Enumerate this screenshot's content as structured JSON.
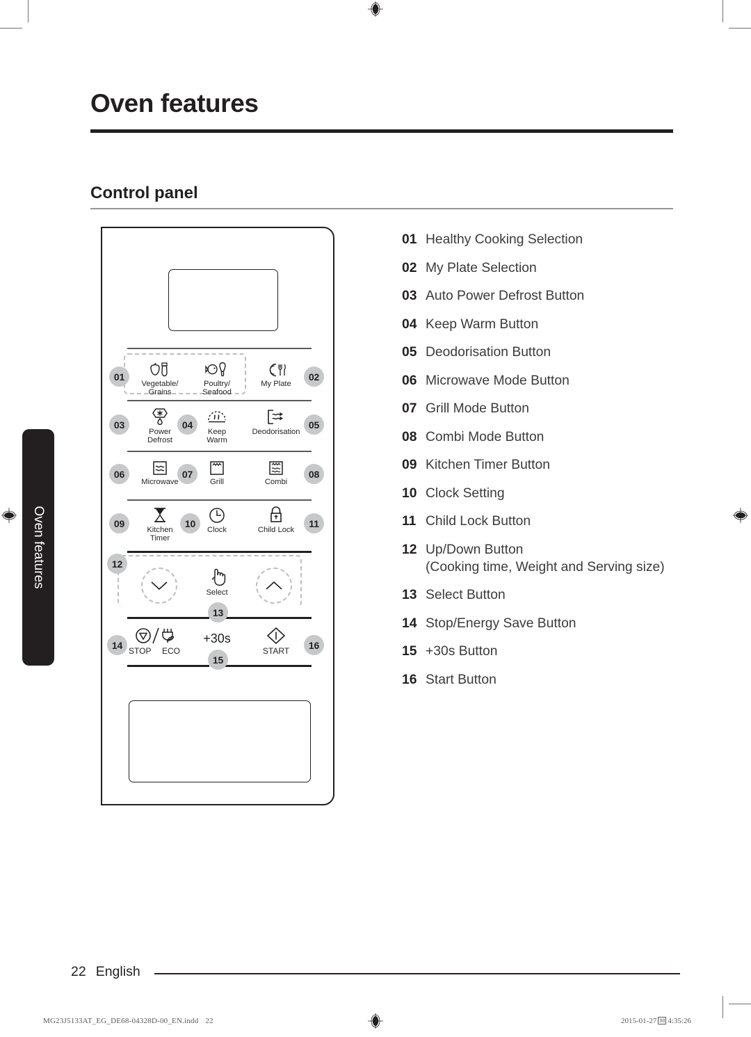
{
  "page": {
    "chapter_title": "Oven features",
    "section_title": "Control panel",
    "side_tab_label": "Oven features",
    "folio_page": "22",
    "folio_language": "English",
    "imprint": "MG23J5133AT_EG_DE68-04328D-00_EN.indd",
    "imprint_page": "22",
    "timestamp_date": "2015-01-27",
    "timestamp_icon": "88",
    "timestamp_time": "4:35:26"
  },
  "colors": {
    "ink": "#231f20",
    "badge_fill": "#c7c8ca",
    "dash_gray": "#bcbec0",
    "rule_gray": "#939598",
    "body_text": "#3a3a3c"
  },
  "control_panel": {
    "keys": [
      {
        "id": "vegetable-grains",
        "label": "Vegetable/\nGrains",
        "icon": "vegetable-icon"
      },
      {
        "id": "poultry-seafood",
        "label": "Poultry/\nSeafood",
        "icon": "poultry-seafood-icon"
      },
      {
        "id": "my-plate",
        "label": "My Plate",
        "icon": "plate-cutlery-icon"
      },
      {
        "id": "power-defrost",
        "label": "Power\nDefrost",
        "icon": "snowflake-droplet-icon"
      },
      {
        "id": "keep-warm",
        "label": "Keep\nWarm",
        "icon": "steam-warm-icon"
      },
      {
        "id": "deodorisation",
        "label": "Deodorisation",
        "icon": "air-vent-icon"
      },
      {
        "id": "microwave",
        "label": "Microwave",
        "icon": "microwave-waves-icon"
      },
      {
        "id": "grill",
        "label": "Grill",
        "icon": "grill-element-icon"
      },
      {
        "id": "combi",
        "label": "Combi",
        "icon": "combi-grill-waves-icon"
      },
      {
        "id": "kitchen-timer",
        "label": "Kitchen\nTimer",
        "icon": "hourglass-icon"
      },
      {
        "id": "clock",
        "label": "Clock",
        "icon": "clock-icon"
      },
      {
        "id": "child-lock",
        "label": "Child Lock",
        "icon": "padlock-icon"
      },
      {
        "id": "down",
        "label": "",
        "icon": "chevron-down-icon"
      },
      {
        "id": "select",
        "label": "Select",
        "icon": "pointing-hand-icon"
      },
      {
        "id": "up",
        "label": "",
        "icon": "chevron-up-icon"
      },
      {
        "id": "stop-eco",
        "label": "STOP   ECO",
        "icon": "stop-eco-icon"
      },
      {
        "id": "plus-30s",
        "label": "+30s",
        "icon": ""
      },
      {
        "id": "start",
        "label": "START",
        "icon": "start-diamond-icon"
      }
    ],
    "callouts": [
      "01",
      "02",
      "03",
      "04",
      "05",
      "06",
      "07",
      "08",
      "09",
      "10",
      "11",
      "12",
      "13",
      "14",
      "15",
      "16"
    ],
    "stop_label": "STOP",
    "eco_label": "ECO",
    "plus30_label": "+30s",
    "start_label": "START"
  },
  "legend": {
    "items": [
      {
        "num": "01",
        "text": "Healthy Cooking Selection"
      },
      {
        "num": "02",
        "text": "My Plate Selection"
      },
      {
        "num": "03",
        "text": "Auto Power Defrost Button"
      },
      {
        "num": "04",
        "text": "Keep Warm Button"
      },
      {
        "num": "05",
        "text": "Deodorisation Button"
      },
      {
        "num": "06",
        "text": "Microwave Mode Button"
      },
      {
        "num": "07",
        "text": "Grill Mode Button"
      },
      {
        "num": "08",
        "text": "Combi Mode Button"
      },
      {
        "num": "09",
        "text": "Kitchen Timer Button"
      },
      {
        "num": "10",
        "text": "Clock Setting"
      },
      {
        "num": "11",
        "text": "Child Lock Button"
      },
      {
        "num": "12",
        "text": "Up/Down Button\n(Cooking time, Weight and Serving size)"
      },
      {
        "num": "13",
        "text": "Select Button"
      },
      {
        "num": "14",
        "text": "Stop/Energy Save Button"
      },
      {
        "num": "15",
        "text": "+30s Button"
      },
      {
        "num": "16",
        "text": "Start Button"
      }
    ]
  }
}
